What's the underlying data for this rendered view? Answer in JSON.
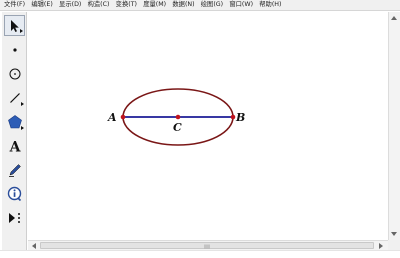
{
  "menu": {
    "items": [
      "文件(F)",
      "编辑(E)",
      "显示(D)",
      "构造(C)",
      "变换(T)",
      "度量(M)",
      "数据(N)",
      "绘图(G)",
      "窗口(W)",
      "帮助(H)"
    ]
  },
  "toolbox": {
    "tools": [
      {
        "name": "arrow-select-tool",
        "active": true
      },
      {
        "name": "point-tool"
      },
      {
        "name": "compass-tool"
      },
      {
        "name": "straightedge-tool"
      },
      {
        "name": "polygon-tool"
      },
      {
        "name": "text-tool",
        "glyph": "A"
      },
      {
        "name": "marker-tool"
      },
      {
        "name": "information-tool"
      },
      {
        "name": "custom-tool"
      }
    ]
  },
  "figure": {
    "points": {
      "A": "A",
      "B": "B",
      "C": "C"
    },
    "colors": {
      "ellipse": "#7a1616",
      "segment": "#1c1c96",
      "point": "#c0141e"
    }
  }
}
